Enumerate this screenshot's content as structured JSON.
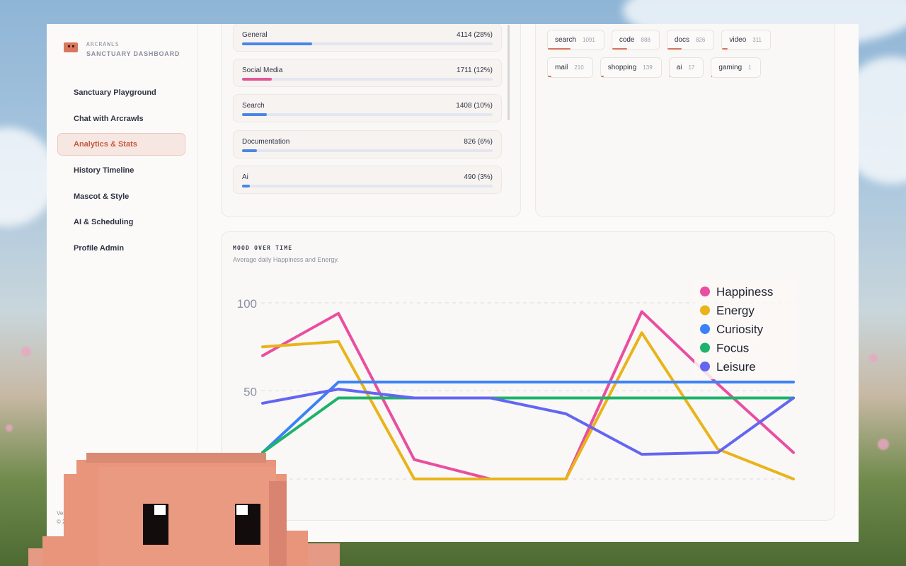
{
  "brand": {
    "small": "ARCRAWLS",
    "title": "SANCTUARY DASHBOARD"
  },
  "nav": [
    {
      "label": "Sanctuary Playground",
      "active": false
    },
    {
      "label": "Chat with Arcrawls",
      "active": false
    },
    {
      "label": "Analytics & Stats",
      "active": true
    },
    {
      "label": "History Timeline",
      "active": false
    },
    {
      "label": "Mascot & Style",
      "active": false
    },
    {
      "label": "AI & Scheduling",
      "active": false
    },
    {
      "label": "Profile Admin",
      "active": false
    }
  ],
  "footer": {
    "line1": "Ver",
    "line2": "© 2"
  },
  "categories": [
    {
      "name": "General",
      "count": "4114 (28%)",
      "fraction": 0.28,
      "color": "#4a86e8"
    },
    {
      "name": "Social Media",
      "count": "1711 (12%)",
      "fraction": 0.12,
      "color": "#e2559a"
    },
    {
      "name": "Search",
      "count": "1408 (10%)",
      "fraction": 0.1,
      "color": "#4a86e8"
    },
    {
      "name": "Documentation",
      "count": "826 (6%)",
      "fraction": 0.06,
      "color": "#4a86e8"
    },
    {
      "name": "Ai",
      "count": "490 (3%)",
      "fraction": 0.03,
      "color": "#4a86e8"
    }
  ],
  "tags": [
    [
      {
        "name": "search",
        "count": "1091"
      },
      {
        "name": "code",
        "count": "888"
      },
      {
        "name": "docs",
        "count": "826"
      },
      {
        "name": "video",
        "count": "311"
      }
    ],
    [
      {
        "name": "mail",
        "count": "210"
      },
      {
        "name": "shopping",
        "count": "139"
      },
      {
        "name": "ai",
        "count": "17"
      },
      {
        "name": "gaming",
        "count": "1"
      }
    ]
  ],
  "chart": {
    "title": "MOOD OVER TIME",
    "subtitle": "Average daily Happiness and Energy."
  },
  "chart_data": {
    "type": "line",
    "title": "MOOD OVER TIME",
    "subtitle": "Average daily Happiness and Energy.",
    "x": [
      0,
      1,
      2,
      3,
      4,
      5,
      6,
      7
    ],
    "ylim": [
      0,
      100
    ],
    "yticks": [
      50,
      100
    ],
    "grid": true,
    "legend": "top-right",
    "series": [
      {
        "name": "Happiness",
        "color": "#e94ea0",
        "values": [
          70,
          94,
          11,
          0,
          0,
          95,
          54,
          15
        ]
      },
      {
        "name": "Energy",
        "color": "#e8b41a",
        "values": [
          75,
          78,
          0,
          0,
          0,
          83,
          17,
          0
        ]
      },
      {
        "name": "Curiosity",
        "color": "#3b82f6",
        "values": [
          15,
          55,
          55,
          55,
          55,
          55,
          55,
          55
        ]
      },
      {
        "name": "Focus",
        "color": "#1db36a",
        "values": [
          15,
          46,
          46,
          46,
          46,
          46,
          46,
          46
        ]
      },
      {
        "name": "Leisure",
        "color": "#6366f1",
        "values": [
          43,
          51,
          46,
          46,
          37,
          14,
          15,
          46
        ]
      }
    ]
  }
}
